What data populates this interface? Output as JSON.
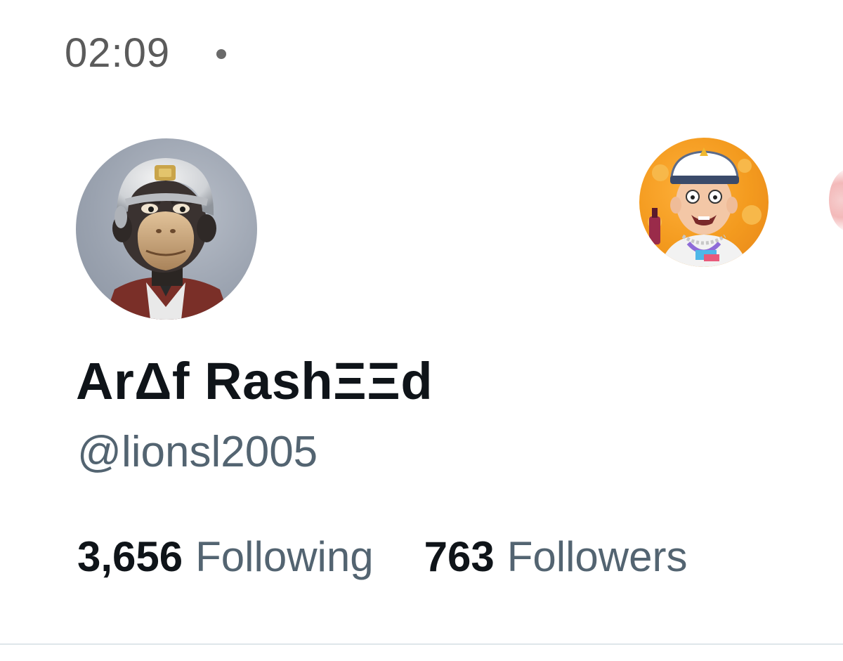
{
  "status_bar": {
    "time": "02:09"
  },
  "profile": {
    "avatar_icon": "bored-ape-avatar",
    "display_name": "ArΔf RashΞΞd",
    "handle": "@lionsl2005",
    "following_count": "3,656",
    "following_label": "Following",
    "followers_count": "763",
    "followers_label": "Followers"
  },
  "side_avatar": {
    "icon": "cartoon-sailor-avatar"
  },
  "colors": {
    "name_text": "#0f1419",
    "secondary_text": "#536471",
    "divider": "#dfe6ea"
  }
}
